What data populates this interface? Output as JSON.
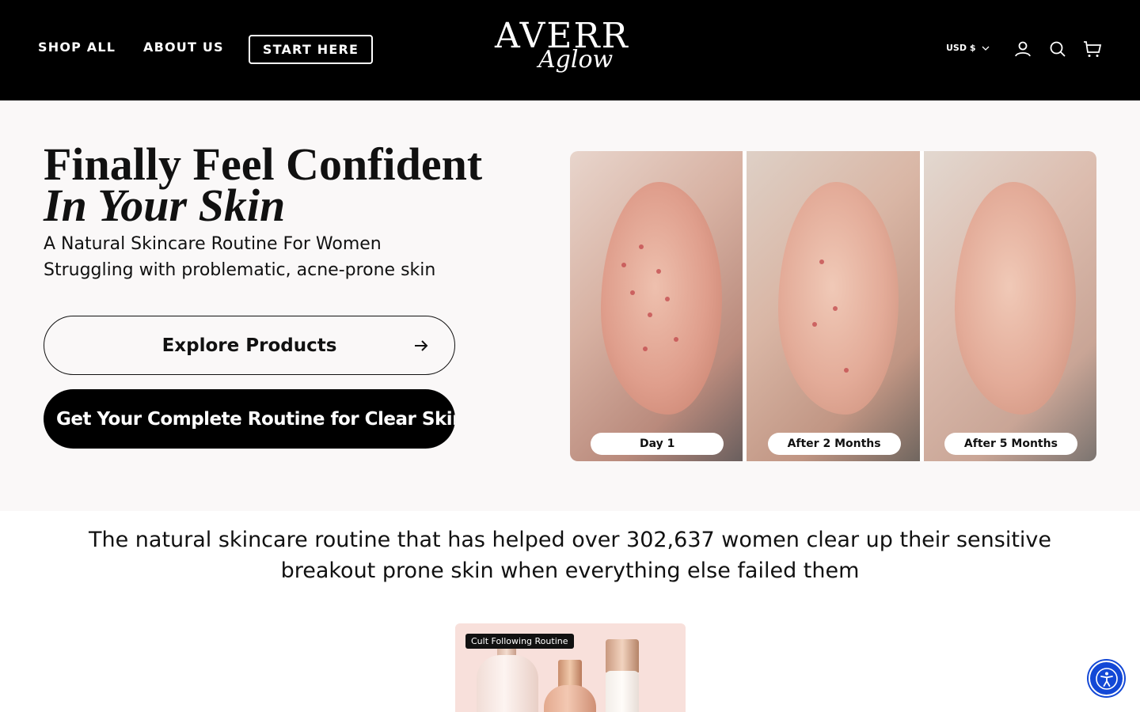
{
  "header": {
    "nav": {
      "shop_all": "SHOP ALL",
      "about_us": "ABOUT US",
      "start_here": "START HERE"
    },
    "logo": {
      "main": "AVERR",
      "script": "Aglow"
    },
    "currency": "USD $",
    "icons": [
      "account-icon",
      "search-icon",
      "cart-icon"
    ]
  },
  "hero": {
    "title_line1": "Finally Feel Confident",
    "title_line2": "In Your Skin",
    "subtitle_line1": "A Natural Skincare Routine For Women",
    "subtitle_line2": "Struggling with problematic, acne-prone skin",
    "explore_button": "Explore Products",
    "routine_button": "Get Your Complete Routine for Clear Skin",
    "before_after_labels": [
      "Day 1",
      "After 2 Months",
      "After 5 Months"
    ]
  },
  "tagline": "The natural skincare routine that has helped over 302,637 women clear up their sensitive breakout prone skin when everything else failed them",
  "product_card": {
    "badge": "Cult Following Routine"
  },
  "colors": {
    "header_bg": "#000000",
    "hero_bg": "#faf8f8",
    "accent_blue": "#1348d6",
    "product_bg": "#f8e0db"
  }
}
